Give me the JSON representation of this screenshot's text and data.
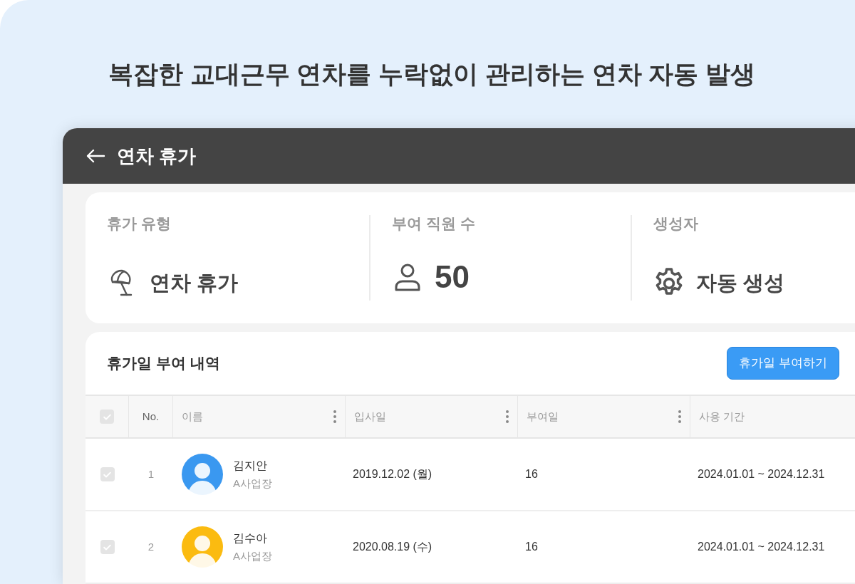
{
  "headline": "복잡한 교대근무 연차를 누락없이 관리하는 연차 자동 발생",
  "window": {
    "title": "연차 휴가"
  },
  "summary": [
    {
      "kind": "leave_type",
      "label": "휴가 유형",
      "value": "연차 휴가"
    },
    {
      "kind": "employees",
      "label": "부여 직원 수",
      "value": "50"
    },
    {
      "kind": "creator",
      "label": "생성자",
      "value": "자동 생성"
    }
  ],
  "history": {
    "title": "휴가일 부여 내역",
    "action": "휴가일 부여하기",
    "header_checked": false,
    "columns": [
      "No.",
      "이름",
      "입사일",
      "부여일",
      "사용 기간"
    ],
    "rows": [
      {
        "checked": false,
        "no": "1",
        "name": "김지안",
        "site": "A사업장",
        "color": "#3a98f0",
        "joined": "2019.12.02 (월)",
        "days": "16",
        "period": "2024.01.01 ~ 2024.12.31"
      },
      {
        "checked": false,
        "no": "2",
        "name": "김수아",
        "site": "A사업장",
        "color": "#fbbb10",
        "joined": "2020.08.19 (수)",
        "days": "16",
        "period": "2024.01.01 ~ 2024.12.31"
      }
    ]
  }
}
